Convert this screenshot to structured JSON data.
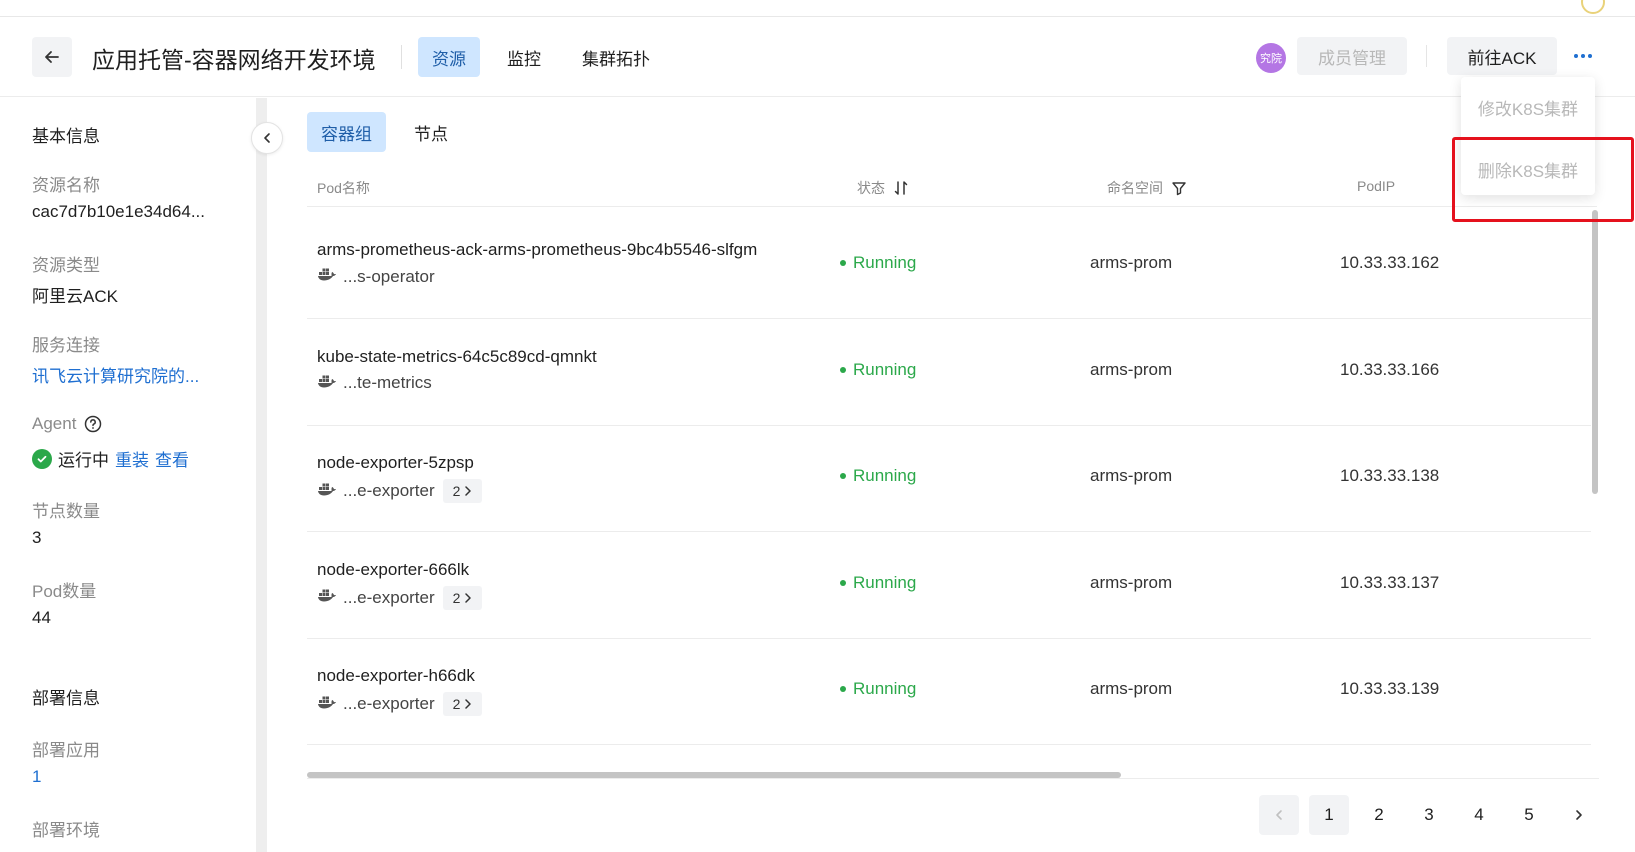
{
  "header": {
    "title": "应用托管-容器网络开发环境",
    "tabs": [
      {
        "label": "资源",
        "active": true
      },
      {
        "label": "监控",
        "active": false
      },
      {
        "label": "集群拓扑",
        "active": false
      }
    ],
    "org_badge": "究院",
    "member_button": "成员管理",
    "ack_button": "前往ACK"
  },
  "dropdown": {
    "items": [
      "修改K8S集群",
      "删除K8S集群"
    ]
  },
  "sidebar": {
    "basic_info": "基本信息",
    "resource_name_label": "资源名称",
    "resource_name_value": "cac7d7b10e1e34d64...",
    "resource_type_label": "资源类型",
    "resource_type_value": "阿里云ACK",
    "service_conn_label": "服务连接",
    "service_conn_value": "讯飞云计算研究院的...",
    "agent_label": "Agent",
    "agent_status": "运行中",
    "agent_reinstall": "重装",
    "agent_view": "查看",
    "node_count_label": "节点数量",
    "node_count_value": "3",
    "pod_count_label": "Pod数量",
    "pod_count_value": "44",
    "deploy_info": "部署信息",
    "deploy_apps_label": "部署应用",
    "deploy_apps_value": "1",
    "deploy_env_label": "部署环境"
  },
  "sub_tabs": [
    {
      "label": "容器组",
      "active": true
    },
    {
      "label": "节点",
      "active": false
    }
  ],
  "table": {
    "columns": [
      "Pod名称",
      "状态",
      "命名空间",
      "PodIP"
    ],
    "rows": [
      {
        "name": "arms-prometheus-ack-arms-prometheus-9bc4b5546-slfgm",
        "container": "...s-operator",
        "extra": "",
        "status": "Running",
        "namespace": "arms-prom",
        "ip": "10.33.33.162"
      },
      {
        "name": "kube-state-metrics-64c5c89cd-qmnkt",
        "container": "...te-metrics",
        "extra": "",
        "status": "Running",
        "namespace": "arms-prom",
        "ip": "10.33.33.166"
      },
      {
        "name": "node-exporter-5zpsp",
        "container": "...e-exporter",
        "extra": "2",
        "status": "Running",
        "namespace": "arms-prom",
        "ip": "10.33.33.138"
      },
      {
        "name": "node-exporter-666lk",
        "container": "...e-exporter",
        "extra": "2",
        "status": "Running",
        "namespace": "arms-prom",
        "ip": "10.33.33.137"
      },
      {
        "name": "node-exporter-h66dk",
        "container": "...e-exporter",
        "extra": "2",
        "status": "Running",
        "namespace": "arms-prom",
        "ip": "10.33.33.139"
      }
    ]
  },
  "pagination": {
    "pages": [
      "1",
      "2",
      "3",
      "4",
      "5"
    ],
    "current": "1"
  },
  "colors": {
    "accent": "#1f6fd1",
    "active_tab_bg": "#cfe6ff",
    "running": "#2ba84a",
    "highlight": "#e5111d"
  }
}
